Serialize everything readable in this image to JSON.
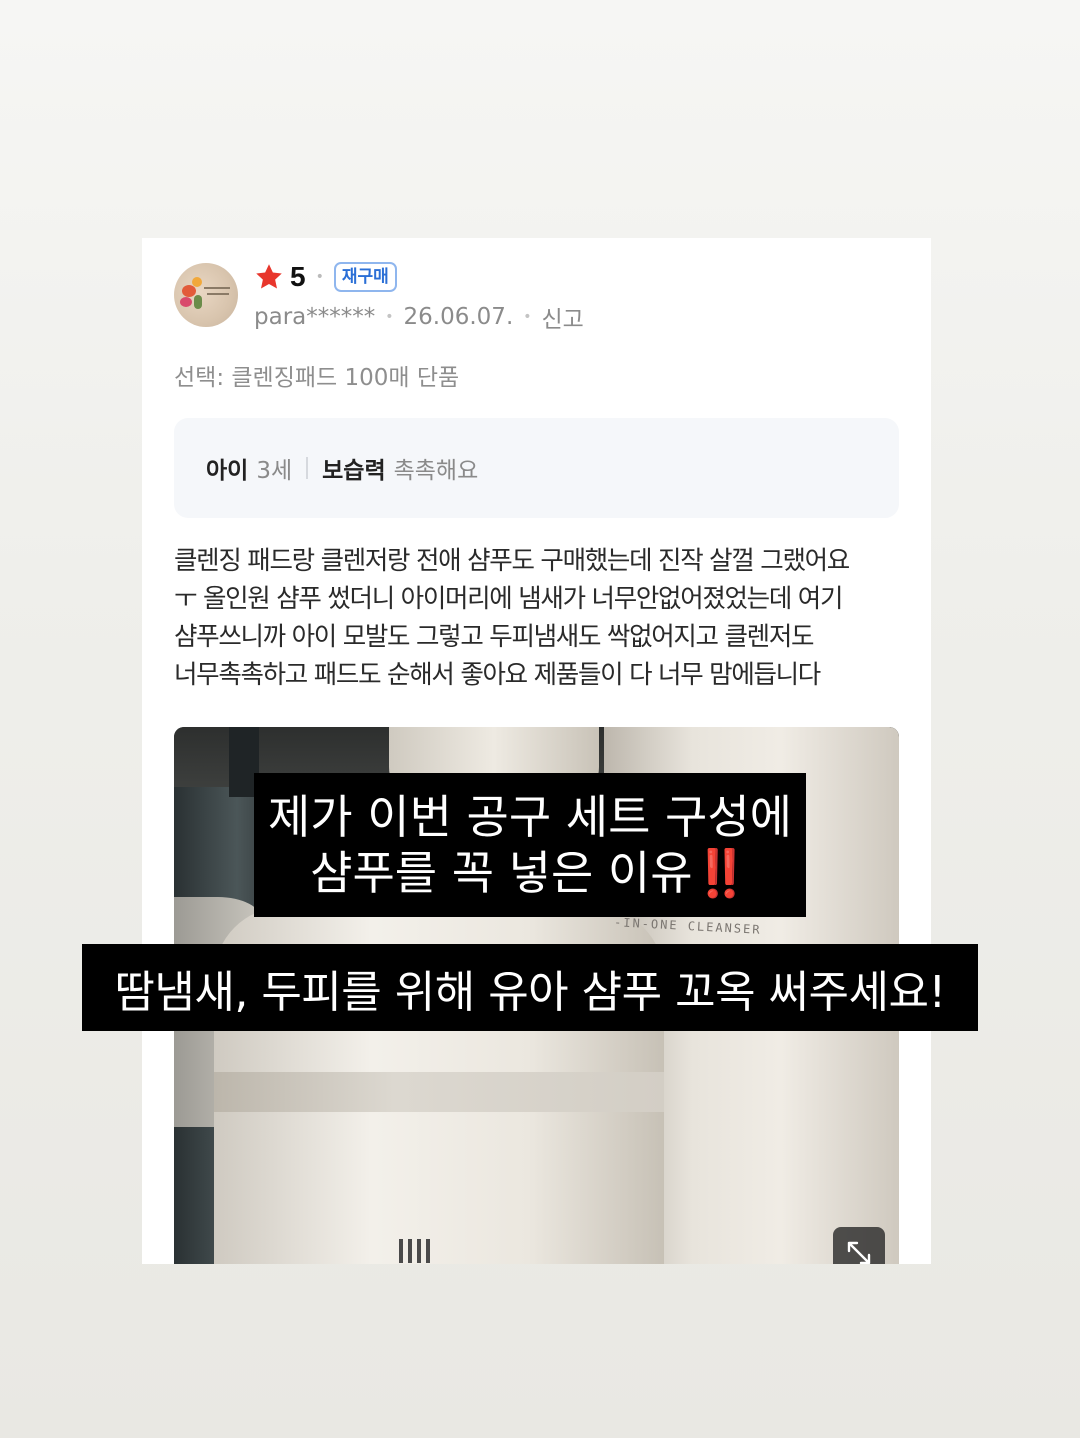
{
  "review": {
    "rating": "5",
    "badge": "재구매",
    "username": "para******",
    "date": "26.06.07.",
    "report": "신고",
    "option": "선택: 클렌징패드 100매 단품",
    "attributes": [
      {
        "key": "아이",
        "value": "3세"
      },
      {
        "key": "보습력",
        "value": "촉촉해요"
      }
    ],
    "text": "클렌징 패드랑 클렌저랑 전애 샴푸도 구매했는데 진작 살껄 그랬어요\nㅜ 올인원 샴푸 썼더니 아이머리에 냄새가 너무안없어졌었는데 여기\n샴푸쓰니까 아이 모발도 그렇고 두피냄새도 싹없어지고 클렌저도\n너무촉촉하고 패드도 순해서 좋아요 제품들이 다 너무 맘에듭니다",
    "photo_product_text": "-IN-ONE CLEANSER"
  },
  "captions": {
    "line1": "제가 이번 공구 세트 구성에",
    "line2": "샴푸를 꼭 넣은 이유",
    "line2_emoji": "‼️",
    "line3": "땀냄새, 두피를 위해 유아 샴푸 꼬옥 써주세요!"
  },
  "icons": {
    "star": "star-icon",
    "expand": "expand-icon"
  },
  "colors": {
    "star": "#e8362c",
    "badge": "#2b6fd6"
  }
}
